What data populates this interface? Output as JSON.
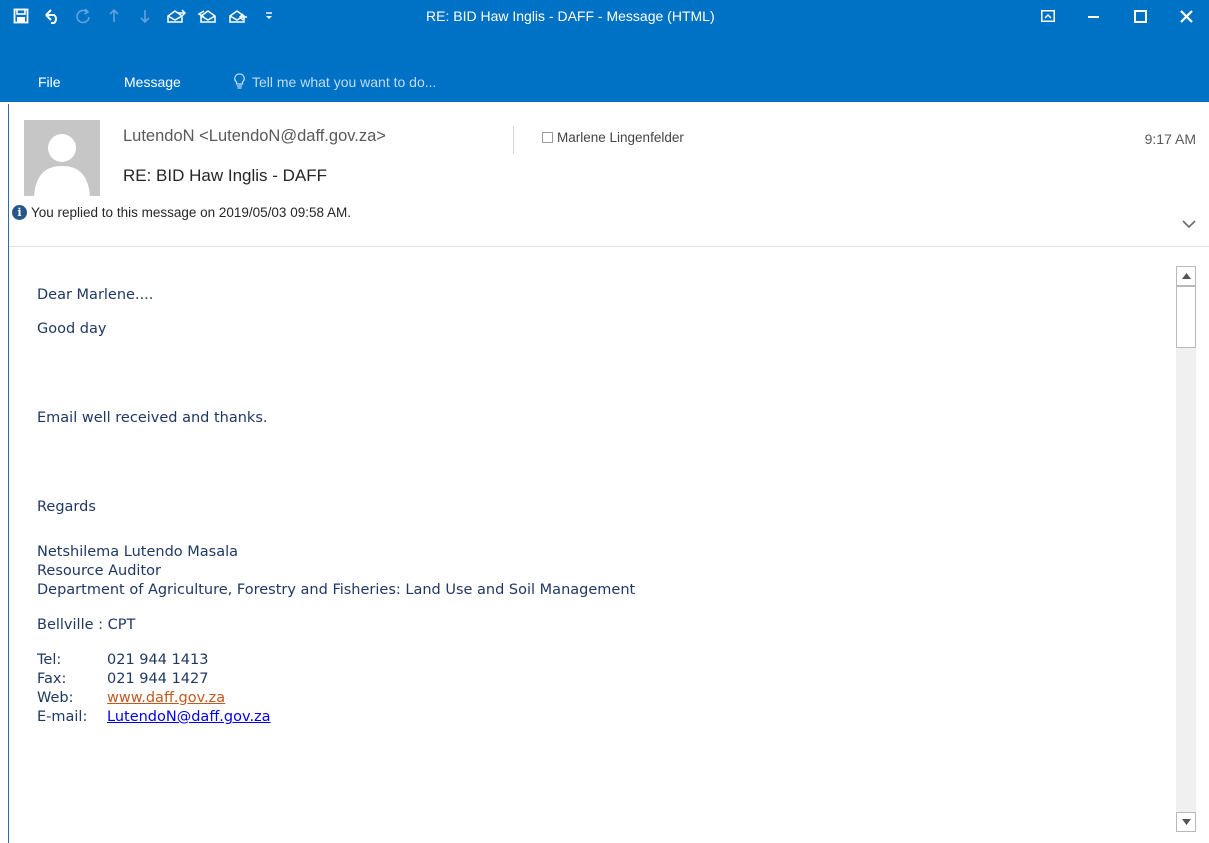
{
  "window": {
    "title": "RE: BID Haw Inglis - DAFF - Message (HTML)",
    "accent_color": "#0072c6"
  },
  "quick_access": [
    "save-icon",
    "undo-icon",
    "redo-icon",
    "up-icon",
    "down-icon",
    "forward-icon",
    "reply-all-icon",
    "reply-icon",
    "customize-icon"
  ],
  "ribbon": {
    "tabs": [
      {
        "label": "File"
      },
      {
        "label": "Message"
      }
    ],
    "tell_me": "Tell me what you want to do..."
  },
  "header": {
    "sender": "LutendoN <LutendoN@daff.gov.za>",
    "recipient": "Marlene Lingenfelder",
    "time": "9:17 AM",
    "subject": "RE: BID Haw Inglis - DAFF",
    "info": "You replied to this message on 2019/05/03 09:58 AM."
  },
  "body": {
    "greeting": "Dear Marlene....",
    "good_day": "Good day",
    "text": "Email well received and thanks.",
    "regards": "Regards",
    "signature": {
      "name": "Netshilema Lutendo Masala",
      "position": "Resource Auditor",
      "department": "Department of Agriculture, Forestry and Fisheries: Land Use and Soil Management",
      "location": "Bellville : CPT",
      "tel_label": "Tel:",
      "tel": "021 944 1413",
      "fax_label": "Fax:",
      "fax": "021 944 1427",
      "web_label": "Web:",
      "web": "www.daff.gov.za",
      "email_label": "E-mail:",
      "email": "LutendoN@daff.gov.za"
    }
  }
}
